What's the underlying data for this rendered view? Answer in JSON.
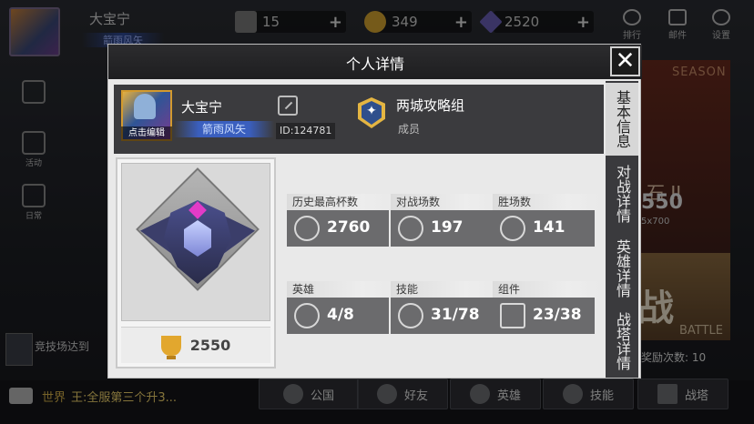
{
  "background": {
    "player_name": "大宝宁",
    "player_title": "箭雨风矢",
    "resources": [
      {
        "icon": "card-icon",
        "value": "15"
      },
      {
        "icon": "coin-icon",
        "value": "349"
      },
      {
        "icon": "gem-icon",
        "value": "2520"
      }
    ],
    "top_buttons": [
      {
        "icon": "rank-icon",
        "label": "排行"
      },
      {
        "icon": "mail-icon",
        "label": "邮件"
      },
      {
        "icon": "gear-icon",
        "label": "设置"
      }
    ],
    "side_buttons": [
      {
        "icon": "shop-icon",
        "label": ""
      },
      {
        "icon": "event-icon",
        "label": "活动"
      },
      {
        "icon": "calendar-icon",
        "label": "日常"
      }
    ],
    "season_label": "SEASON",
    "season_rank": "石 II",
    "season_points": "550",
    "season_sub": "5x700",
    "battle_label": "BATTLE",
    "battle_char": "战",
    "rewards_text": "奖励次数: 10",
    "notice_text": "竞技场达到",
    "chat": {
      "channel": "世界",
      "message": "王:全服第三个升3..."
    },
    "nav": [
      {
        "icon": "guild-icon",
        "label": "公国"
      },
      {
        "icon": "friends-icon",
        "label": "好友"
      },
      {
        "icon": "hero-icon",
        "label": "英雄"
      },
      {
        "icon": "skill-icon",
        "label": "技能"
      },
      {
        "icon": "tower-icon",
        "label": "战塔"
      }
    ]
  },
  "dialog": {
    "title": "个人详情",
    "close_icon": "close-icon",
    "tabs": [
      "基本信息",
      "对战详情",
      "英雄详情",
      "战塔详情"
    ],
    "active_tab": 0,
    "profile": {
      "name": "大宝宁",
      "title": "箭雨风矢",
      "avatar_edit_label": "点击编辑",
      "id_text": "ID:124781",
      "guild_name": "两城攻略组",
      "guild_role": "成员"
    },
    "rank": {
      "trophies": "2550"
    },
    "stats": [
      {
        "label": "历史最高杯数",
        "icon": "trophy-icon",
        "value": "2760"
      },
      {
        "label": "对战场数",
        "icon": "crossed-swords-icon",
        "value": "197"
      },
      {
        "label": "胜场数",
        "icon": "sword-laurel-icon",
        "value": "141"
      },
      {
        "label": "英雄",
        "icon": "hero-helmet-icon",
        "value": "4/8"
      },
      {
        "label": "技能",
        "icon": "skill-flame-icon",
        "value": "31/78"
      },
      {
        "label": "组件",
        "icon": "castle-icon",
        "value": "23/38"
      }
    ]
  },
  "colors": {
    "accent_gold": "#e2a72e",
    "title_blue": "#3a5fbf",
    "emblem_magenta": "#e23bc7",
    "chat_yellow": "#f1d36c"
  }
}
